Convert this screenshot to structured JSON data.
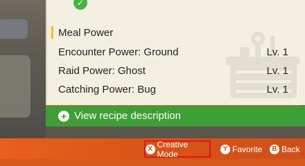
{
  "meal_power": {
    "title": "Meal Power",
    "rows": [
      {
        "name": "Encounter Power: Ground",
        "level": "Lv. 1"
      },
      {
        "name": "Raid Power: Ghost",
        "level": "Lv. 1"
      },
      {
        "name": "Catching Power: Bug",
        "level": "Lv. 1"
      }
    ]
  },
  "recipe": {
    "label": "View recipe description",
    "icon": "plus-circle-icon"
  },
  "controls": {
    "creative": {
      "key": "X",
      "label": "Creative Mode"
    },
    "favorite": {
      "key": "Y",
      "label": "Favorite"
    },
    "back": {
      "key": "B",
      "label": "Back"
    }
  },
  "colors": {
    "accent_green": "#3f9e37",
    "bottom_orange": "#d85418",
    "highlight_red": "#e2141b",
    "marker_yellow": "#f0c21b"
  }
}
